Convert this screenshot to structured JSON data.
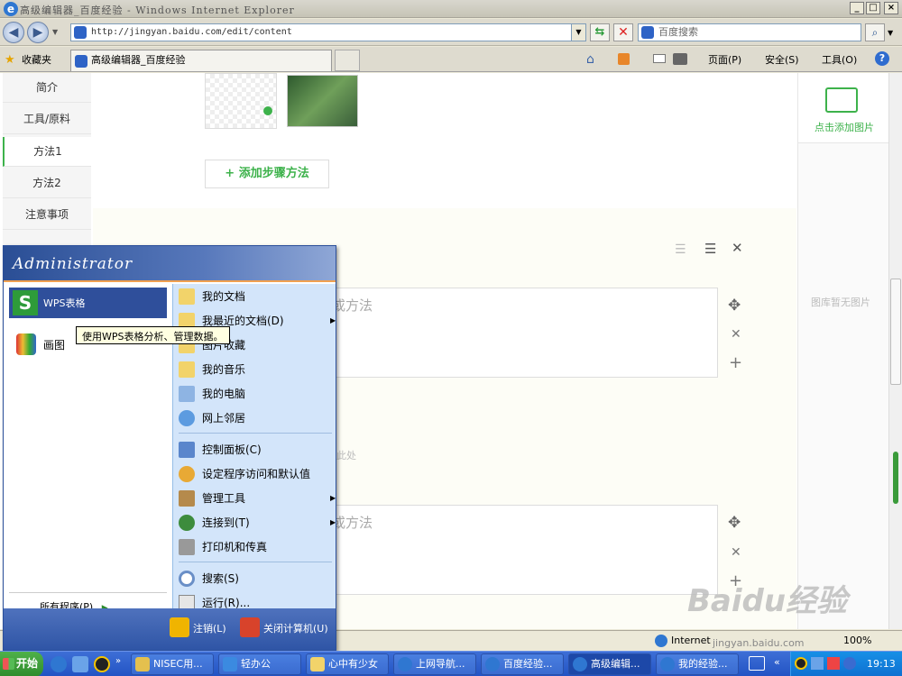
{
  "window": {
    "title": "高级编辑器_百度经验 - Windows Internet Explorer",
    "minimize": "_",
    "maximize": "□",
    "close": "×"
  },
  "address_bar": {
    "url": "http://jingyan.baidu.com/edit/content",
    "search_placeholder": "百度搜索"
  },
  "tab_bar": {
    "favorites": "收藏夹",
    "tab_title": "高级编辑器_百度经验",
    "page_menu": "页面(P)",
    "safety_menu": "安全(S)",
    "tools_menu": "工具(O)"
  },
  "left_nav": {
    "items": [
      {
        "label": "简介"
      },
      {
        "label": "工具/原料"
      },
      {
        "label": "方法1"
      },
      {
        "label": "方法2"
      },
      {
        "label": "注意事项"
      }
    ]
  },
  "editor": {
    "add_step_button": "+ 添加步骤方法",
    "step_placeholder_1": "或方法",
    "step_placeholder_2": "或方法",
    "hint_text": "此处"
  },
  "right_pane": {
    "add_image": "点击添加图片",
    "no_image": "图库暂无图片"
  },
  "start_menu": {
    "user": "Administrator",
    "pinned": [
      {
        "label": "WPS表格"
      },
      {
        "label": "画图"
      }
    ],
    "tooltip": "使用WPS表格分析、管理数据。",
    "all_programs": "所有程序(P)",
    "right_items": [
      {
        "label": "我的文档"
      },
      {
        "label": "我最近的文档(D)"
      },
      {
        "label": "图片收藏"
      },
      {
        "label": "我的音乐"
      },
      {
        "label": "我的电脑"
      },
      {
        "label": "网上邻居"
      },
      {
        "label": "控制面板(C)"
      },
      {
        "label": "设定程序访问和默认值"
      },
      {
        "label": "管理工具"
      },
      {
        "label": "连接到(T)"
      },
      {
        "label": "打印机和传真"
      },
      {
        "label": "搜索(S)"
      },
      {
        "label": "运行(R)..."
      }
    ],
    "logoff": "注销(L)",
    "shutdown": "关闭计算机(U)"
  },
  "status_bar": {
    "zone": "Internet",
    "zoom": "100%"
  },
  "taskbar": {
    "start": "开始",
    "buttons": [
      {
        "label": "NISEC用..."
      },
      {
        "label": "轻办公"
      },
      {
        "label": "心中有少女"
      },
      {
        "label": "上网导航..."
      },
      {
        "label": "百度经验..."
      },
      {
        "label": "高级编辑..."
      },
      {
        "label": "我的经验..."
      }
    ],
    "clock": "19:13"
  },
  "watermark": {
    "brand": "Baidu经验",
    "url": "jingyan.baidu.com"
  }
}
